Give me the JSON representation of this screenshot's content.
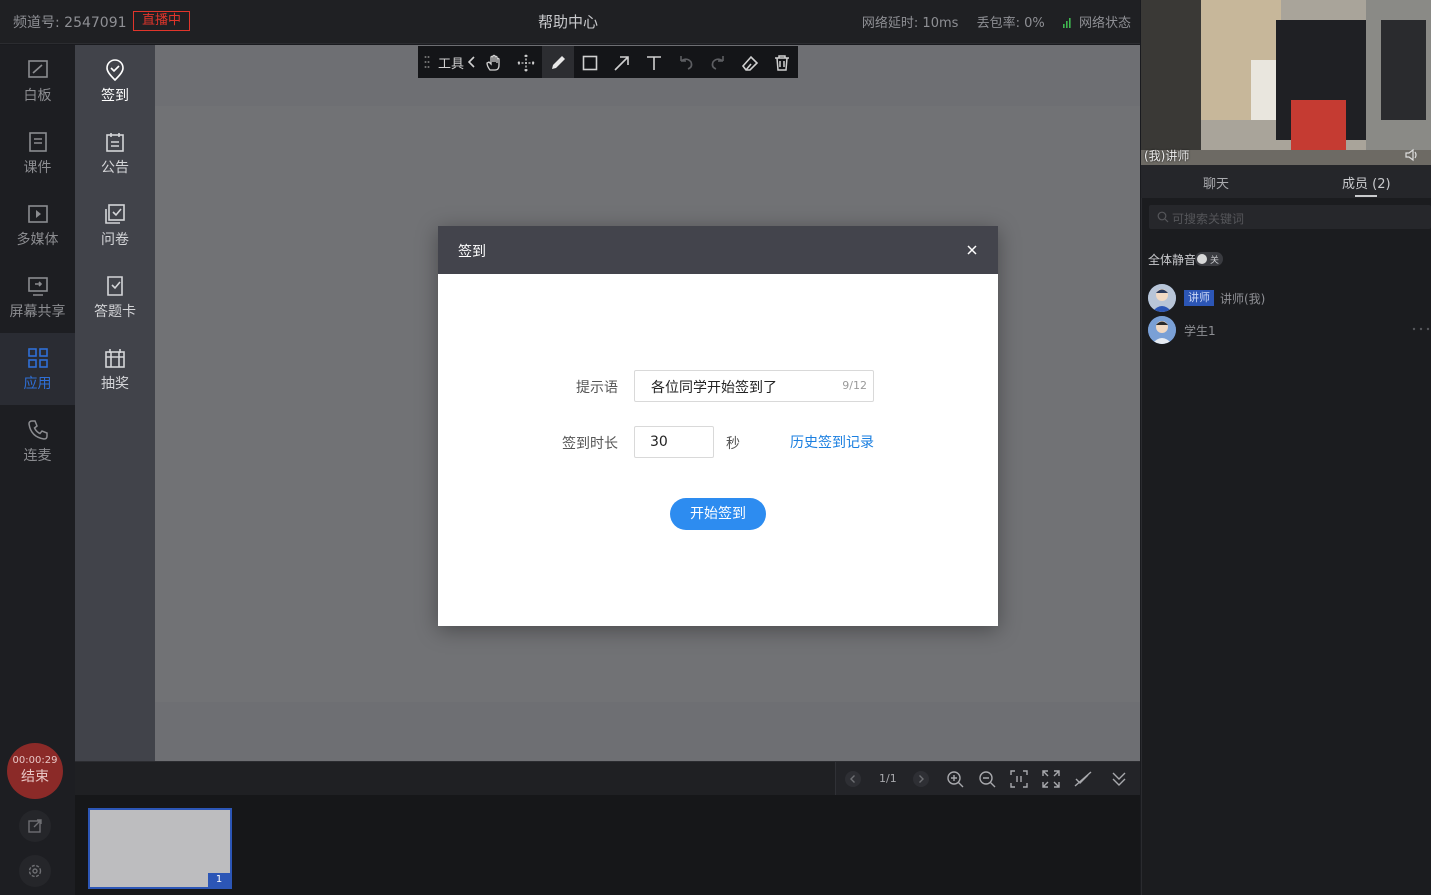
{
  "topbar": {
    "channel": "频道号: 2547091",
    "live_badge": "直播中",
    "title": "帮助中心",
    "latency": "网络延时: 10ms",
    "packet_loss": "丢包率: 0%",
    "network_status": "网络状态",
    "colors": {
      "live": "#e0352b",
      "signal": "#3fb950"
    }
  },
  "rail": {
    "items": [
      {
        "label": "白板",
        "icon": "whiteboard-icon"
      },
      {
        "label": "课件",
        "icon": "courseware-icon"
      },
      {
        "label": "多媒体",
        "icon": "media-icon"
      },
      {
        "label": "屏幕共享",
        "icon": "screen-share-icon"
      },
      {
        "label": "应用",
        "icon": "apps-icon",
        "active": true
      },
      {
        "label": "连麦",
        "icon": "phone-icon"
      }
    ],
    "end": {
      "time": "00:00:29",
      "label": "结束"
    },
    "accent_color": "#2f6fd6"
  },
  "submenu": {
    "items": [
      {
        "label": "签到",
        "icon": "checkin-icon"
      },
      {
        "label": "公告",
        "icon": "announcement-icon"
      },
      {
        "label": "问卷",
        "icon": "survey-icon"
      },
      {
        "label": "答题卡",
        "icon": "answer-card-icon"
      },
      {
        "label": "抽奖",
        "icon": "lottery-icon"
      }
    ]
  },
  "toolbar": {
    "label": "工具",
    "tools": [
      "hand-icon",
      "move-icon",
      "pen-icon",
      "rectangle-icon",
      "arrow-icon",
      "text-icon",
      "undo-icon",
      "redo-icon",
      "eraser-icon",
      "trash-icon"
    ]
  },
  "pager": {
    "page_info": "1/1",
    "thumb_number": "1",
    "controls": [
      "prev-page-icon",
      "next-page-icon",
      "zoom-in-icon",
      "zoom-out-icon",
      "fit-icon",
      "fullscreen-icon",
      "annotate-icon",
      "collapse-icon"
    ]
  },
  "right_panel": {
    "video_label": "(我)讲师",
    "tabs": {
      "chat": "聊天",
      "members": "成员 (2)"
    },
    "search_placeholder": "可搜索关键词",
    "mute_all": "全体静音",
    "toggle_state": "关",
    "members": [
      {
        "tag": "讲师",
        "name": "讲师(我)"
      },
      {
        "name": "学生1"
      }
    ]
  },
  "modal": {
    "title": "签到",
    "prompt_label": "提示语",
    "prompt_value": "各位同学开始签到了",
    "prompt_count": "9/12",
    "duration_label": "签到时长",
    "duration_value": "30",
    "duration_unit": "秒",
    "history_link": "历史签到记录",
    "start_button": "开始签到",
    "button_color": "#2d8cf0"
  }
}
